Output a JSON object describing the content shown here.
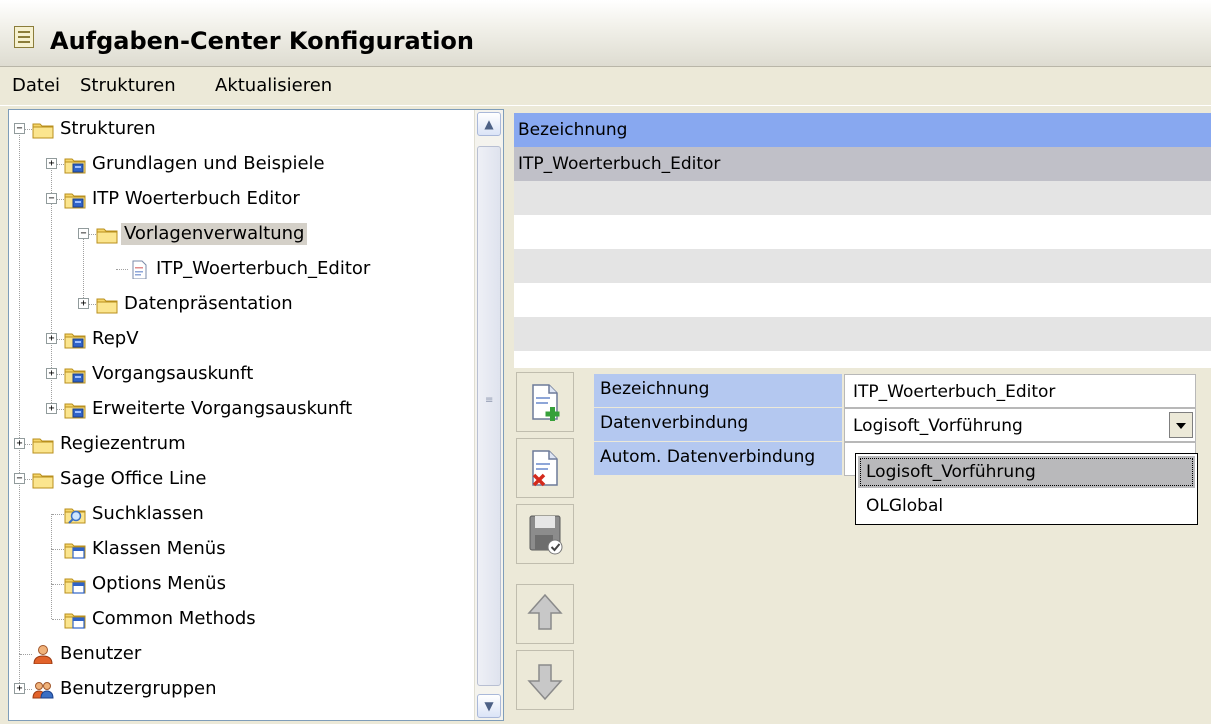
{
  "window": {
    "title": "Aufgaben-Center Konfiguration",
    "title_icon": "notepad-icon"
  },
  "menu": {
    "items": [
      "Datei",
      "Strukturen",
      "Aktualisieren"
    ]
  },
  "tree": {
    "nodes": [
      {
        "label": "Strukturen",
        "icon": "folder-icon",
        "expander": "−",
        "level": 0
      },
      {
        "label": "Grundlagen und Beispiele",
        "icon": "shared-folder-icon",
        "expander": "+",
        "level": 1
      },
      {
        "label": "ITP Woerterbuch Editor",
        "icon": "shared-folder-icon",
        "expander": "−",
        "level": 1
      },
      {
        "label": "Vorlagenverwaltung",
        "icon": "folder-icon",
        "expander": "−",
        "level": 2,
        "selected": true
      },
      {
        "label": "ITP_Woerterbuch_Editor",
        "icon": "document-icon",
        "expander": "",
        "level": 3
      },
      {
        "label": "Datenpräsentation",
        "icon": "folder-icon",
        "expander": "+",
        "level": 2
      },
      {
        "label": "RepV",
        "icon": "shared-folder-icon",
        "expander": "+",
        "level": 1
      },
      {
        "label": "Vorgangsauskunft",
        "icon": "shared-folder-icon",
        "expander": "+",
        "level": 1
      },
      {
        "label": "Erweiterte Vorgangsauskunft",
        "icon": "shared-folder-icon",
        "expander": "+",
        "level": 1
      },
      {
        "label": "Regiezentrum",
        "icon": "folder-icon",
        "expander": "+",
        "level": 0
      },
      {
        "label": "Sage Office Line",
        "icon": "folder-icon",
        "expander": "−",
        "level": 0
      },
      {
        "label": "Suchklassen",
        "icon": "search-folder-icon",
        "expander": "",
        "level": 1
      },
      {
        "label": "Klassen Menüs",
        "icon": "menu-folder-icon",
        "expander": "",
        "level": 1
      },
      {
        "label": "Options Menüs",
        "icon": "menu-folder-icon",
        "expander": "",
        "level": 1
      },
      {
        "label": "Common Methods",
        "icon": "menu-folder-icon",
        "expander": "",
        "level": 1
      },
      {
        "label": "Benutzer",
        "icon": "user-icon",
        "expander": "",
        "level": 0
      },
      {
        "label": "Benutzergruppen",
        "icon": "user-group-icon",
        "expander": "+",
        "level": 0
      }
    ]
  },
  "grid": {
    "header": "Bezeichnung",
    "rows": [
      "ITP_Woerterbuch_Editor",
      "",
      "",
      "",
      "",
      "",
      ""
    ]
  },
  "toolbar": {
    "buttons": [
      "add-document-icon",
      "delete-document-icon",
      "save-icon",
      "arrow-up-icon",
      "arrow-down-icon"
    ]
  },
  "properties": {
    "bezeichnung": {
      "label": "Bezeichnung",
      "value": "ITP_Woerterbuch_Editor"
    },
    "datenverbindung": {
      "label": "Datenverbindung",
      "value": "Logisoft_Vorführung"
    },
    "autom": {
      "label": "Autom. Datenverbindung",
      "value": ""
    }
  },
  "dropdown": {
    "options": [
      "Logisoft_Vorführung",
      "OLGlobal"
    ],
    "selected_index": 0
  },
  "colors": {
    "grid_header": "#88a8f0",
    "selected_row": "#c0c0c8",
    "prop_label": "#b4c8f0"
  }
}
